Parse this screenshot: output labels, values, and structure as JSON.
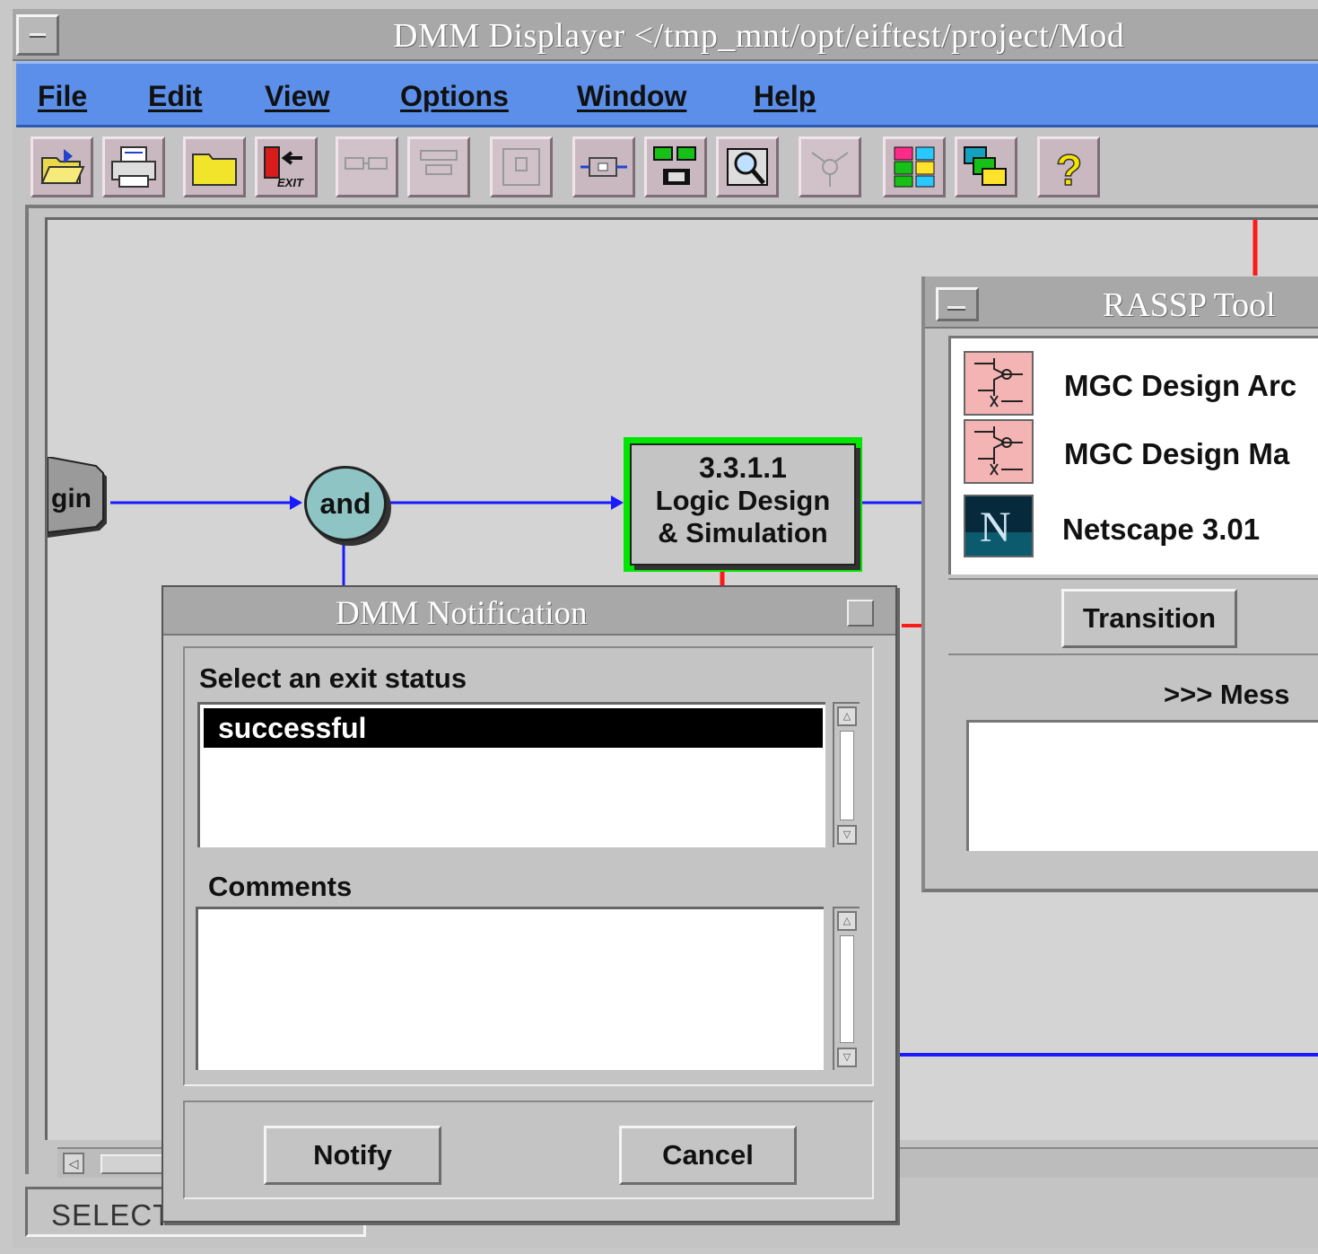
{
  "window": {
    "title": "DMM Displayer </tmp_mnt/opt/eiftest/project/Mod"
  },
  "menu": [
    {
      "label": "File"
    },
    {
      "label": "Edit"
    },
    {
      "label": "View"
    },
    {
      "label": "Options"
    },
    {
      "label": "Window"
    },
    {
      "label": "Help"
    }
  ],
  "toolbar": {
    "tools": [
      {
        "icon": "open-folder-icon"
      },
      {
        "icon": "print-icon"
      },
      {
        "icon": "folder-icon"
      },
      {
        "icon": "exit-icon",
        "label": "EXIT"
      },
      {
        "icon": "chain-icon"
      },
      {
        "icon": "layout-icon"
      },
      {
        "icon": "frame-icon"
      },
      {
        "icon": "process-icon"
      },
      {
        "icon": "hierarchy-icon"
      },
      {
        "icon": "zoom-icon"
      },
      {
        "icon": "network-icon"
      },
      {
        "icon": "grid-icon"
      },
      {
        "icon": "stack-icon"
      },
      {
        "icon": "help-icon",
        "label": "?"
      }
    ]
  },
  "canvas": {
    "nodes": {
      "begin_label": "gin",
      "and_label": "and",
      "task_id": "3.3.1.1",
      "task_line1": "Logic Design",
      "task_line2": "& Simulation"
    },
    "colors": {
      "link": "#1a1aff",
      "link_red": "#ff1a1a",
      "task_highlight": "#00e600"
    }
  },
  "status": {
    "text": "SELECT"
  },
  "rassp": {
    "title": "RASSP Tool",
    "tools": [
      {
        "name": "MGC Design Arc"
      },
      {
        "name": "MGC Design Ma"
      },
      {
        "name": "Netscape 3.01"
      }
    ],
    "transition_label": "Transition",
    "messages_label": ">>> Mess"
  },
  "dialog": {
    "title": "DMM Notification",
    "exit_label": "Select an exit status",
    "exit_options": [
      "successful"
    ],
    "comments_label": "Comments",
    "comments_value": "",
    "notify_label": "Notify",
    "cancel_label": "Cancel"
  }
}
